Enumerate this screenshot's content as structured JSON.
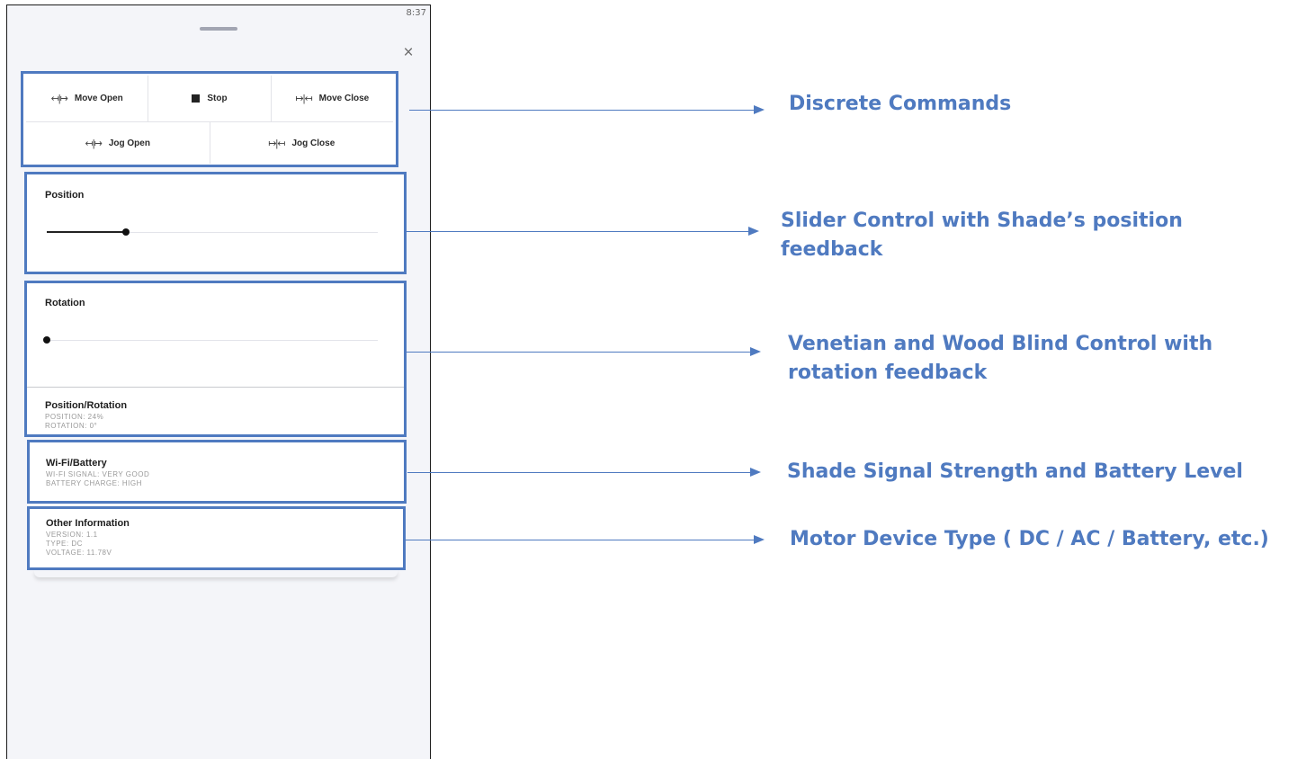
{
  "status_bar": {
    "time": "8:37"
  },
  "close_symbol": "×",
  "commands": {
    "move_open": {
      "icon": "↤|↦",
      "label": "Move Open"
    },
    "stop": {
      "label": "Stop"
    },
    "move_close": {
      "icon": "↦|↤",
      "label": "Move Close"
    },
    "jog_open": {
      "icon": "↤|↦",
      "label": "Jog Open"
    },
    "jog_close": {
      "icon": "↦|↤",
      "label": "Jog Close"
    }
  },
  "position": {
    "label": "Position",
    "value_fraction": 0.24
  },
  "rotation": {
    "label": "Rotation",
    "value_fraction": 0.0
  },
  "position_rotation": {
    "label": "Position/Rotation",
    "position": "POSITION: 24%",
    "rotation": "ROTATION: 0°"
  },
  "wifi_battery": {
    "label": "Wi-Fi/Battery",
    "signal": "WI-FI SIGNAL: VERY GOOD",
    "battery": "BATTERY CHARGE: HIGH"
  },
  "other_info": {
    "label": "Other Information",
    "version": "VERSION: 1.1",
    "type": "TYPE: DC",
    "voltage": "VOLTAGE: 11.78V"
  },
  "annotations": {
    "discrete": "Discrete Commands",
    "slider_line1": "Slider Control with Shade’s position",
    "slider_line2": "feedback",
    "venetian_line1": "Venetian and Wood Blind Control with",
    "venetian_line2": "rotation feedback",
    "signal": "Shade Signal Strength and Battery Level",
    "motor": "Motor Device Type ( DC / AC / Battery, etc.)"
  },
  "colors": {
    "annotation_blue": "#4f7ac0",
    "panel_bg": "#f4f5f9"
  }
}
